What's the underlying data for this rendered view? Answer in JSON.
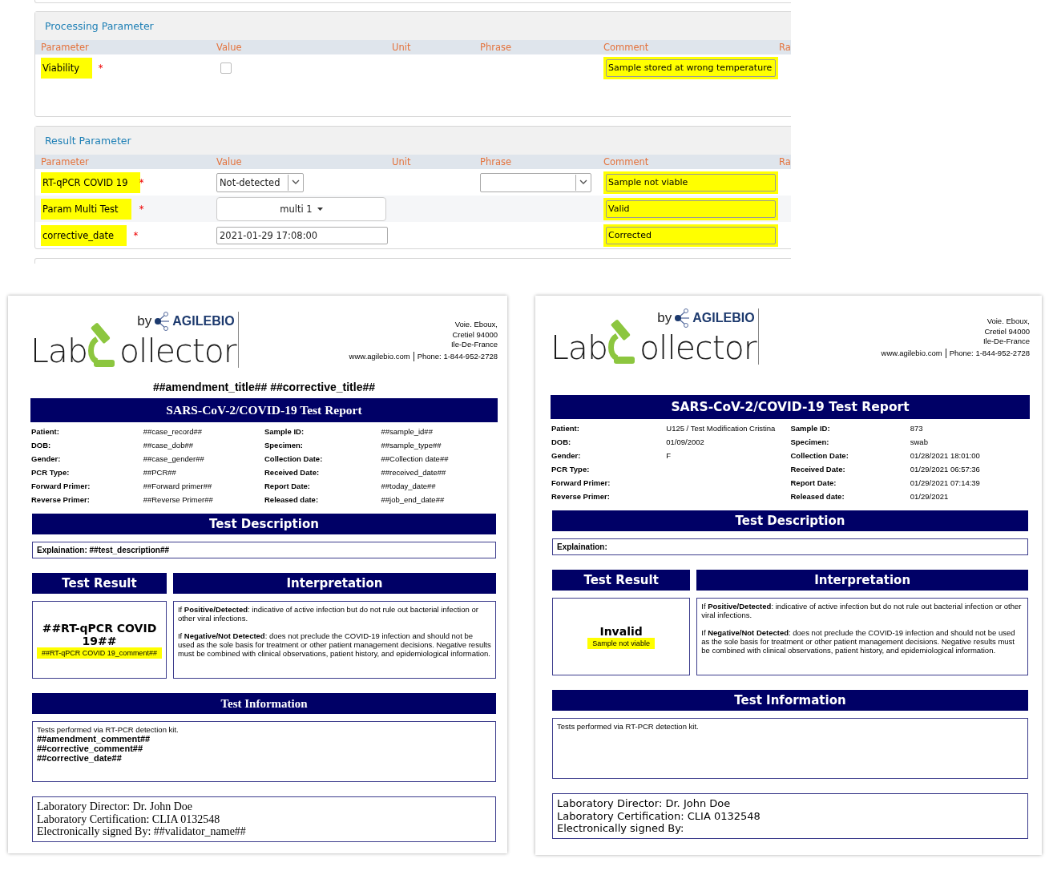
{
  "parameter_panels": [
    {
      "title": "Processing Parameter",
      "columns": [
        "Parameter",
        "Value",
        "Unit",
        "Phrase",
        "Comment",
        "Ra"
      ],
      "rows": [
        {
          "parameter": "Viability",
          "required_mark": "*",
          "parameter_highlighted": true,
          "value": {
            "kind": "checkbox",
            "checked": false
          },
          "comment": "Sample stored at wrong temperature",
          "comment_highlighted": true
        }
      ]
    },
    {
      "title": "Result Parameter",
      "columns": [
        "Parameter",
        "Value",
        "Unit",
        "Phrase",
        "Comment",
        "Ra"
      ],
      "rows": [
        {
          "parameter": "RT-qPCR COVID 19",
          "required_mark": "*",
          "parameter_highlighted": true,
          "value": {
            "kind": "select",
            "text": "Not-detected"
          },
          "phrase": {
            "kind": "select"
          },
          "comment": "Sample not viable",
          "comment_highlighted": true
        },
        {
          "parameter": "Param Multi Test",
          "required_mark": "*",
          "parameter_highlighted": true,
          "value": {
            "kind": "multi",
            "text": "multi 1"
          },
          "comment": "Valid",
          "comment_highlighted": true
        },
        {
          "parameter": "corrective_date",
          "required_mark": "*",
          "parameter_highlighted": true,
          "value": {
            "kind": "input",
            "text": "2021-01-29 17:08:00"
          },
          "comment": "Corrected",
          "comment_highlighted": true
        }
      ]
    }
  ],
  "reports": [
    {
      "kind": "template",
      "logo": {
        "by": "by",
        "brand": "AGILEBIO",
        "name_start": "Lab",
        "name_end": "ollector"
      },
      "address": [
        "Voie. Eboux,",
        "Cretiel 94000",
        "Ile-De-France"
      ],
      "website": "www.agilebio.com",
      "phone": "Phone: 1-844-952-2728",
      "heading": "##amendment_title## ##corrective_title##",
      "title": "SARS-CoV-2/COVID-19 Test Report",
      "fields": [
        {
          "left": {
            "label": "Patient:",
            "value": "##case_record##"
          },
          "right": {
            "label": "Sample ID:",
            "value": "##sample_id##"
          }
        },
        {
          "left": {
            "label": "DOB:",
            "value": "##case_dob##"
          },
          "right": {
            "label": "Specimen:",
            "value": "##sample_type##"
          }
        },
        {
          "left": {
            "label": "Gender:",
            "value": "##case_gender##"
          },
          "right": {
            "label": "Collection Date:",
            "value": "##Collection date##"
          }
        },
        {
          "left": {
            "label": "PCR Type:",
            "value": "##PCR##"
          },
          "right": {
            "label": "Received Date:",
            "value": "##received_date##"
          }
        },
        {
          "left": {
            "label": "Forward Primer:",
            "value": "##Forward primer##"
          },
          "right": {
            "label": "Report Date:",
            "value": "##today_date##"
          }
        },
        {
          "left": {
            "label": "Reverse Primer:",
            "value": "##Reverse Primer##"
          },
          "right": {
            "label": "Released date:",
            "value": "##job_end_date##"
          }
        }
      ],
      "description": {
        "title": "Test Description",
        "text": "Explaination: ##test_description##"
      },
      "result": {
        "title": "Test Result",
        "value": "##RT-qPCR COVID 19##",
        "comment": "##RT-qPCR COVID 19_comment##",
        "comment_highlighted": true
      },
      "interpretation": {
        "title": "Interpretation",
        "paragraphs": [
          "If **Positive/Detected**: indicative of active infection but do not rule out bacterial infection or other viral infections.",
          "If **Negative/Not Detected**: does not preclude the COVID-19 infection and should not be used as the sole basis for treatment or other patient management decisions. Negative results must be combined with clinical observations, patient history, and epidemiological information."
        ]
      },
      "information": {
        "title": "Test Information",
        "lines": [
          {
            "text": "Tests performed via RT-PCR detection kit.",
            "bold": false
          },
          {
            "text": "##amendment_comment##",
            "bold": true
          },
          {
            "text": "##corrective_comment##",
            "bold": true
          },
          {
            "text": "##corrective_date##",
            "bold": true
          }
        ]
      },
      "signature": [
        "Laboratory Director: Dr. John Doe",
        "Laboratory Certification: CLIA 0132548",
        "Electronically signed By: ##validator_name##"
      ]
    },
    {
      "kind": "filled",
      "logo": {
        "by": "by",
        "brand": "AGILEBIO",
        "name_start": "Lab",
        "name_end": "ollector"
      },
      "address": [
        "Voie. Eboux,",
        "Cretiel 94000",
        "Ile-De-France"
      ],
      "website": "www.agilebio.com",
      "phone": "Phone: 1-844-952-2728",
      "title": "SARS-CoV-2/COVID-19 Test Report",
      "fields": [
        {
          "left": {
            "label": "Patient:",
            "value": "U125 / Test Modification Cristina"
          },
          "right": {
            "label": "Sample ID:",
            "value": "873"
          }
        },
        {
          "left": {
            "label": "DOB:",
            "value": "01/09/2002"
          },
          "right": {
            "label": "Specimen:",
            "value": "swab"
          }
        },
        {
          "left": {
            "label": "Gender:",
            "value": "F"
          },
          "right": {
            "label": "Collection Date:",
            "value": "01/28/2021 18:01:00"
          }
        },
        {
          "left": {
            "label": "PCR Type:"
          },
          "right": {
            "label": "Received Date:",
            "value": "01/29/2021 06:57:36"
          }
        },
        {
          "left": {
            "label": "Forward Primer:"
          },
          "right": {
            "label": "Report Date:",
            "value": "01/29/2021 07:14:39"
          }
        },
        {
          "left": {
            "label": "Reverse Primer:"
          },
          "right": {
            "label": "Released date:",
            "value": "01/29/2021"
          }
        }
      ],
      "description": {
        "title": "Test Description",
        "text": "Explaination:"
      },
      "result": {
        "title": "Test Result",
        "value": "Invalid",
        "comment": "Sample not viable",
        "comment_highlighted": true
      },
      "interpretation": {
        "title": "Interpretation",
        "paragraphs": [
          "If **Positive/Detected**: indicative of active infection but do not rule out bacterial infection or other viral infections.",
          "If **Negative/Not Detected**: does not preclude the COVID-19 infection and should not be used as the sole basis for treatment or other patient management decisions. Negative results must be combined with clinical observations, patient history, and epidemiological information."
        ]
      },
      "information": {
        "title": "Test Information",
        "lines": [
          {
            "text": "Tests performed via RT-PCR detection kit.",
            "bold": false
          }
        ]
      },
      "signature": [
        "Laboratory Director: Dr. John Doe",
        "Laboratory Certification: CLIA 0132548",
        "Electronically signed By:"
      ]
    }
  ]
}
